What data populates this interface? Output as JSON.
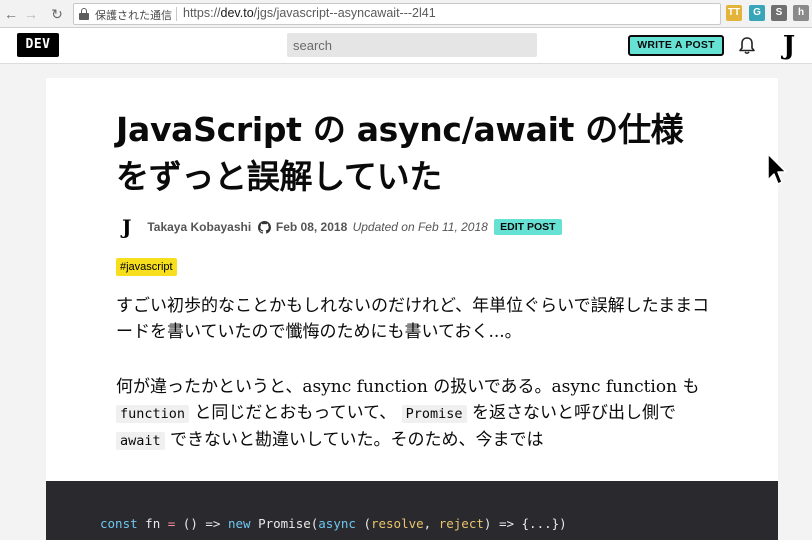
{
  "browser": {
    "secure_label": "保護された通信",
    "url_prefix": "https://",
    "url_host": "dev.to",
    "url_path": "/jgs/javascript--asyncawait---2l41",
    "extensions": [
      "TT",
      "G",
      "S",
      "h"
    ]
  },
  "header": {
    "logo": "DEV",
    "search_placeholder": "search",
    "write_post_label": "WRITE A POST",
    "avatar_glyph": "J"
  },
  "article": {
    "title_line1": "JavaScript の async/await の仕様",
    "title_line2": "をずっと誤解していた",
    "author_avatar_glyph": "J",
    "author": "Takaya Kobayashi",
    "date": "Feb 08, 2018",
    "updated": "Updated on Feb 11, 2018",
    "edit_label": "EDIT POST",
    "tag": "#javascript",
    "p1": "すごい初歩的なことかもしれないのだけれど、年単位ぐらいで誤解したままコードを書いていたので懺悔のためにも書いておく...。",
    "p2_a": "何が違ったかというと、async function の扱いである。async function も ",
    "p2_code1": "function",
    "p2_b": " と同じだとおもっていて、 ",
    "p2_code2": "Promise",
    "p2_c": " を返さないと呼び出し側で ",
    "p2_code3": "await",
    "p2_d": " できないと勘違いしていた。そのため、今までは",
    "code": {
      "t1": "const",
      "t2": " fn ",
      "t3": "=",
      "t4": " () => ",
      "t5": "new",
      "t6": " Promise(",
      "t7": "async",
      "t8": " (",
      "t9": "resolve",
      "t10": ", ",
      "t11": "reject",
      "t12": ") => {...})"
    }
  },
  "colors": {
    "accent": "#66e2d5",
    "tag_bg": "#f7df1e",
    "code_bg": "#29292e"
  }
}
